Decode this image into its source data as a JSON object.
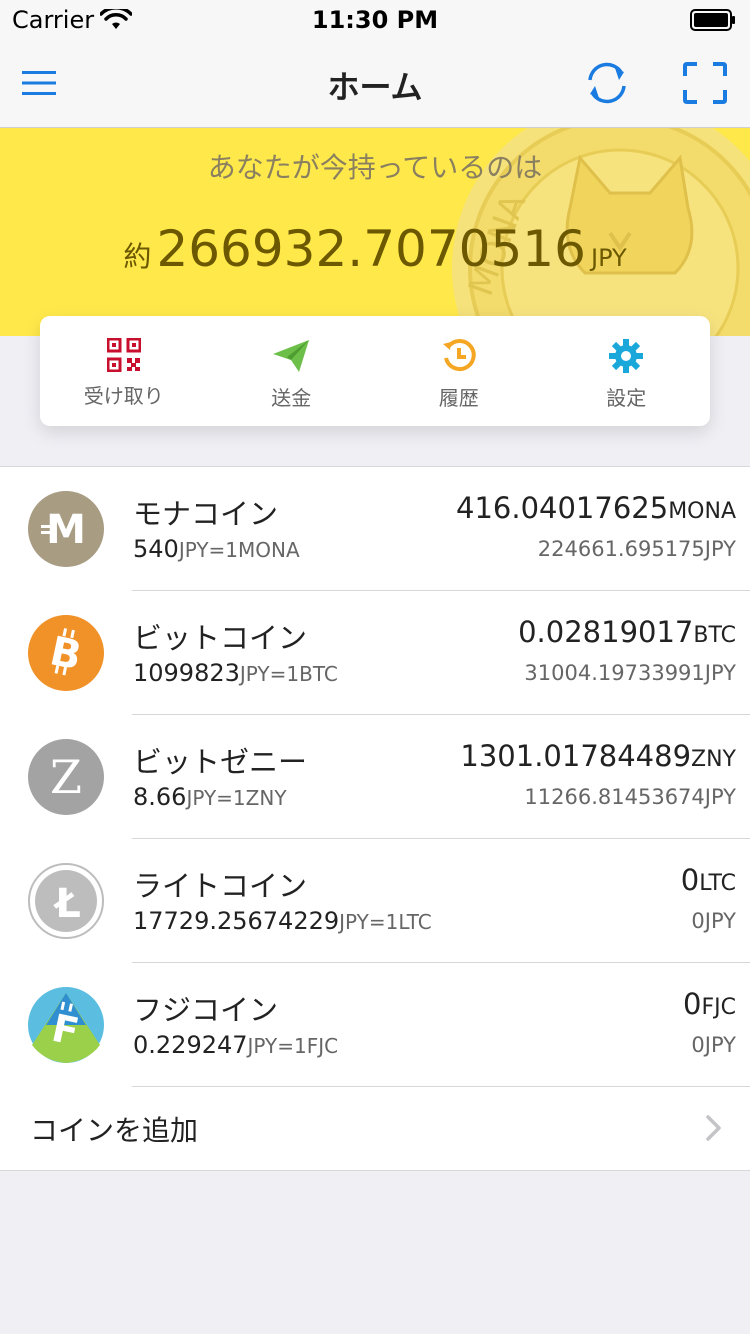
{
  "status": {
    "carrier": "Carrier",
    "time": "11:30 PM"
  },
  "nav": {
    "title": "ホーム"
  },
  "banner": {
    "subtitle": "あなたが今持っているのは",
    "prefix": "約",
    "total": "266932.7070516",
    "unit": "JPY"
  },
  "actions": [
    {
      "label": "受け取り",
      "icon": "qr-code-icon"
    },
    {
      "label": "送金",
      "icon": "send-icon"
    },
    {
      "label": "履歴",
      "icon": "history-icon"
    },
    {
      "label": "設定",
      "icon": "gear-icon"
    }
  ],
  "coins": [
    {
      "name": "モナコイン",
      "rate": "540",
      "rate_unit": "JPY=1MONA",
      "balance": "416.04017625",
      "balance_unit": "MONA",
      "jpy": "224661.695175JPY",
      "icon": "monacoin-icon"
    },
    {
      "name": "ビットコイン",
      "rate": "1099823",
      "rate_unit": "JPY=1BTC",
      "balance": "0.02819017",
      "balance_unit": "BTC",
      "jpy": "31004.19733991JPY",
      "icon": "bitcoin-icon"
    },
    {
      "name": "ビットゼニー",
      "rate": "8.66",
      "rate_unit": "JPY=1ZNY",
      "balance": "1301.01784489",
      "balance_unit": "ZNY",
      "jpy": "11266.81453674JPY",
      "icon": "bitzeny-icon"
    },
    {
      "name": "ライトコイン",
      "rate": "17729.25674229",
      "rate_unit": "JPY=1LTC",
      "balance": "0",
      "balance_unit": "LTC",
      "jpy": "0JPY",
      "icon": "litecoin-icon"
    },
    {
      "name": "フジコイン",
      "rate": "0.229247",
      "rate_unit": "JPY=1FJC",
      "balance": "0",
      "balance_unit": "FJC",
      "jpy": "0JPY",
      "icon": "fujicoin-icon"
    }
  ],
  "add_coin": {
    "label": "コインを追加"
  },
  "colors": {
    "accent": "#1a7be0",
    "banner": "#ffe94a",
    "receive": "#c8102e",
    "send": "#6cc04a",
    "history": "#f5a623",
    "settings": "#1aa7d9"
  }
}
